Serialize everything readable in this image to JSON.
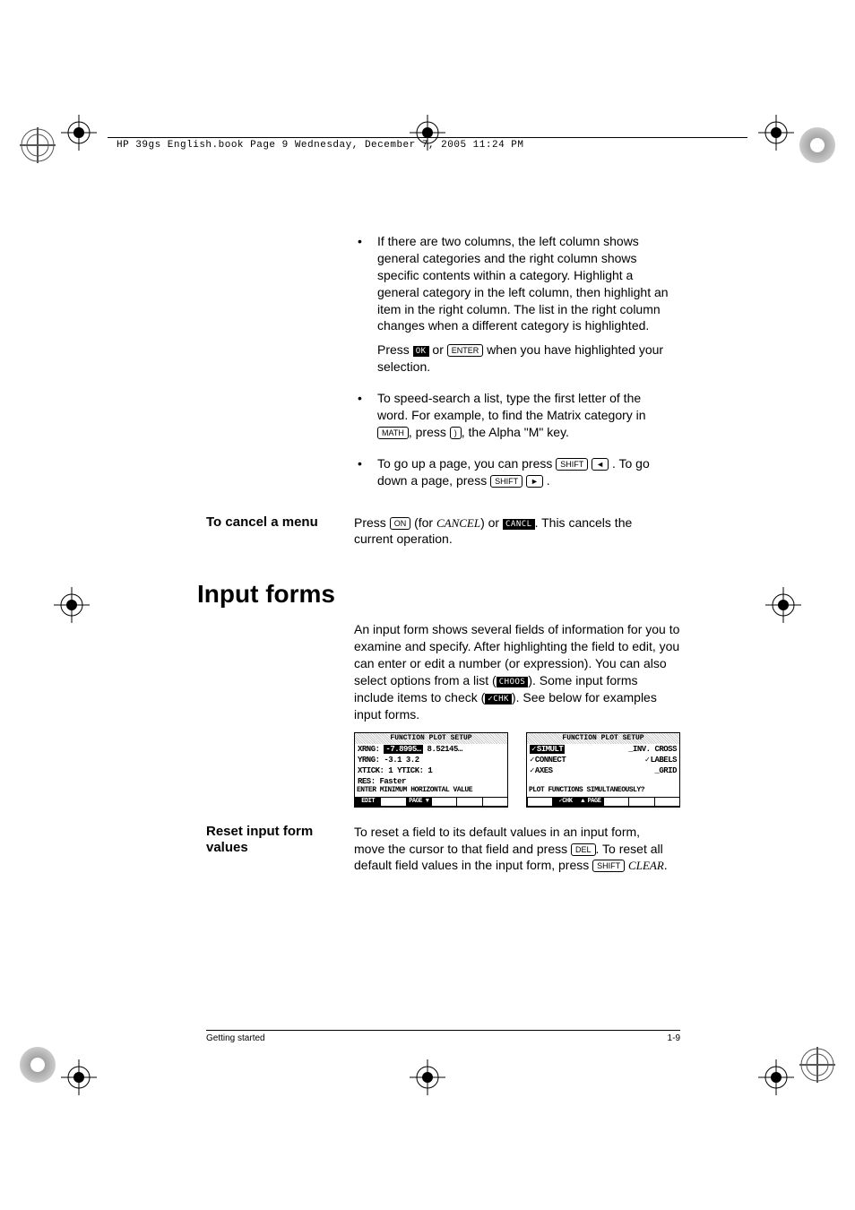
{
  "header": "HP 39gs English.book  Page 9  Wednesday, December 7, 2005  11:24 PM",
  "bullets": {
    "b1": "If there are two columns, the left column shows general categories and the right column shows specific contents within a category. Highlight a general category in the left column, then highlight an item in the right column. The list in the right column changes when a different category is highlighted.",
    "b1b_pre": "Press ",
    "b1b_ok": "OK",
    "b1b_mid": " or ",
    "b1b_enter": "ENTER",
    "b1b_post": " when you have highlighted your selection.",
    "b2a": "To speed-search a list, type the first letter of the word. For example, to find the Matrix category in ",
    "b2_math": "MATH",
    "b2b": ", press ",
    "b2_key": ")",
    "b2c": ", the Alpha \"M\" key.",
    "b3a": "To go up a page, you can press ",
    "b3_shift": "SHIFT",
    "b3_left": "◄",
    "b3b": " . To go down a page, press ",
    "b3_shift2": "SHIFT",
    "b3_right": "►",
    "b3c": " ."
  },
  "cancel": {
    "heading": "To cancel a menu",
    "a": "Press ",
    "on": "ON",
    "b": " (for ",
    "cancel_word": "CANCEL",
    "c": ") or ",
    "cncl": "CANCL",
    "d": ". This cancels the current operation."
  },
  "section_heading": "Input forms",
  "intro": {
    "a": "An input form shows several fields of information for you to examine and specify. After highlighting the field to edit, you can enter or edit a number (or expression). You can also select options from a list (",
    "choos": "CHOOS",
    "b": "). Some input forms include items to check (",
    "chk": "✓CHK",
    "c": "). See below for examples input forms."
  },
  "screen1": {
    "title": "FUNCTION PLOT SETUP",
    "l1a": "XRNG:",
    "l1b": "-7.8995…",
    "l1c": "8.52145…",
    "l2": "YRNG: -3.1      3.2",
    "l3": "XTICK: 1       YTICK: 1",
    "l4": "RES:  Faster",
    "msg": "ENTER MINIMUM HORIZONTAL VALUE",
    "m1": "EDIT",
    "m2": "PAGE ▼"
  },
  "screen2": {
    "title": "FUNCTION PLOT SETUP",
    "l1a": "SIMULT",
    "l1b": "_INV. CROSS",
    "l2a": "CONNECT",
    "l2b": "LABELS",
    "l3a": "AXES",
    "l3b": "_GRID",
    "msg": "PLOT FUNCTIONS SIMULTANEOUSLY?",
    "m1": "✓CHK",
    "m2": "▲ PAGE"
  },
  "reset": {
    "heading": "Reset input form values",
    "a": "To reset a field to its default values in an input form, move the cursor to that field and press ",
    "del": "DEL",
    "b": ". To reset all default field values in the input form, press",
    "shift": "SHIFT",
    "clear": "CLEAR",
    "c": "."
  },
  "footer_left": "Getting started",
  "footer_right": "1-9"
}
